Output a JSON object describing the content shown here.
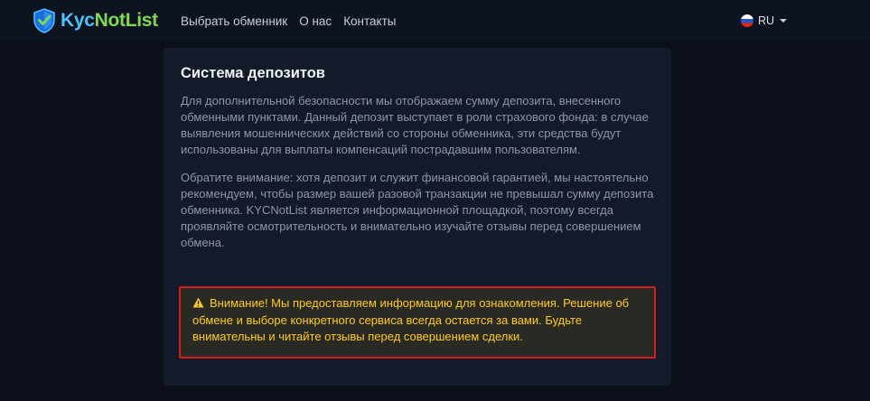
{
  "brand": {
    "name_part1": "Kyc",
    "name_part2": "Not",
    "name_part3": "List",
    "logo_icon": "shield-check-icon"
  },
  "nav": {
    "items": [
      {
        "label": "Выбрать обменник"
      },
      {
        "label": "О нас"
      },
      {
        "label": "Контакты"
      }
    ]
  },
  "language": {
    "selected": "RU",
    "flag_icon": "russia-flag-icon"
  },
  "deposit_section": {
    "title": "Система депозитов",
    "paragraph1": "Для дополнительной безопасности мы отображаем сумму депозита, внесенного обменными пунктами. Данный депозит выступает в роли страхового фонда: в случае выявления мошеннических действий со стороны обменника, эти средства будут использованы для выплаты компенсаций пострадавшим пользователям.",
    "paragraph2": "Обратите внимание: хотя депозит и служит финансовой гарантией, мы настоятельно рекомендуем, чтобы размер вашей разовой транзакции не превышал сумму депозита обменника. KYCNotList является информационной площадкой, поэтому всегда проявляйте осмотрительность и внимательно изучайте отзывы перед совершением обмена."
  },
  "warning": {
    "icon": "warning-triangle-icon",
    "text": "Внимание! Мы предоставляем информацию для ознакомления. Решение об обмене и выборе конкретного сервиса всегда остается за вами. Будьте внимательны и читайте отзывы перед совершением сделки."
  },
  "colors": {
    "background": "#0b0f19",
    "navbar": "#0e1320",
    "card": "#131a2a",
    "warning_text": "#ffc928",
    "warning_border": "#d61c1c",
    "brand_blue": "#4cc2ff",
    "brand_green": "#7ed957"
  }
}
